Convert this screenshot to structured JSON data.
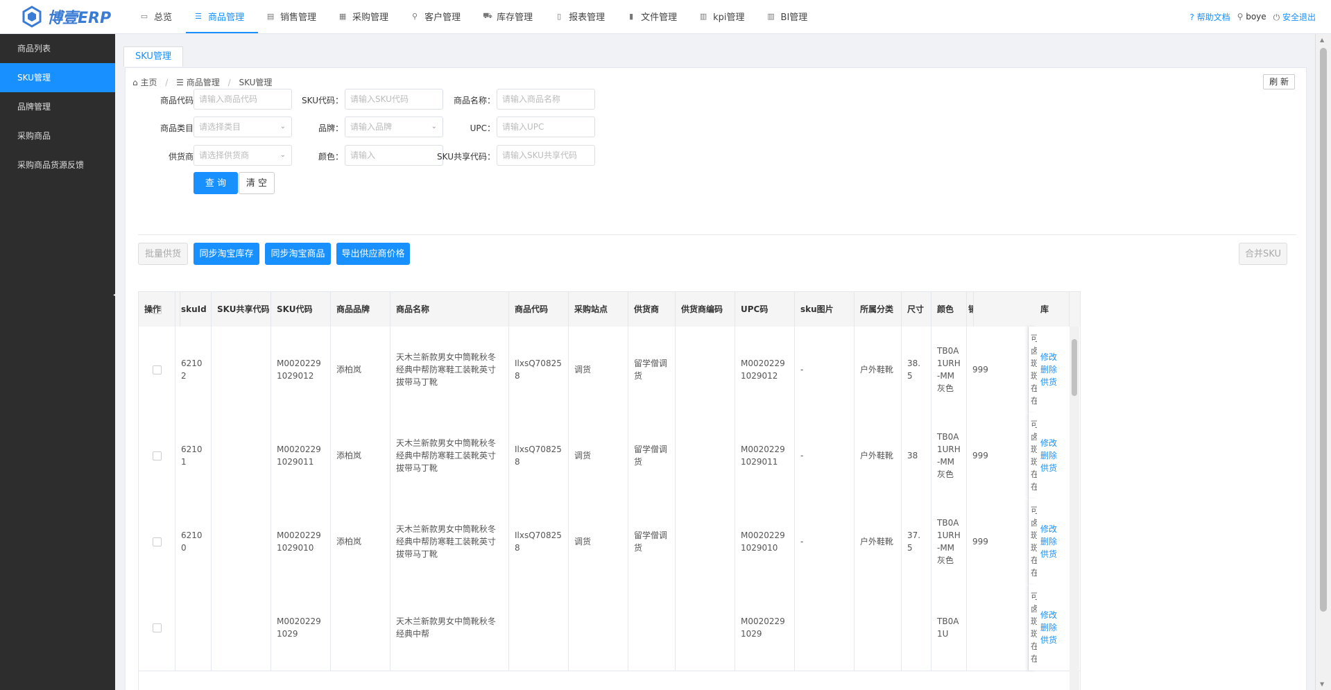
{
  "app": {
    "logo_text": "博壹ERP"
  },
  "nav": [
    {
      "label": "总览",
      "icon": "monitor-icon"
    },
    {
      "label": "商品管理",
      "icon": "list-icon",
      "active": true
    },
    {
      "label": "销售管理",
      "icon": "clipboard-icon"
    },
    {
      "label": "采购管理",
      "icon": "grid-icon"
    },
    {
      "label": "客户管理",
      "icon": "user-icon"
    },
    {
      "label": "库存管理",
      "icon": "cart-icon"
    },
    {
      "label": "报表管理",
      "icon": "document-icon"
    },
    {
      "label": "文件管理",
      "icon": "file-icon"
    },
    {
      "label": "kpi管理",
      "icon": "chart-icon"
    },
    {
      "label": "BI管理",
      "icon": "chart-icon"
    }
  ],
  "topright": {
    "help": "帮助文档",
    "user": "boye",
    "logout": "安全退出"
  },
  "sidebar": [
    {
      "label": "商品列表"
    },
    {
      "label": "SKU管理",
      "active": true
    },
    {
      "label": "品牌管理"
    },
    {
      "label": "采购商品"
    },
    {
      "label": "采购商品货源反馈"
    }
  ],
  "tab": {
    "label": "SKU管理"
  },
  "breadcrumb": {
    "home": "主页",
    "section": "商品管理",
    "current": "SKU管理"
  },
  "refresh_label": "刷 新",
  "filters": {
    "product_code": {
      "label": "商品代码：",
      "placeholder": "请输入商品代码"
    },
    "sku_code": {
      "label": "SKU代码：",
      "placeholder": "请输入SKU代码"
    },
    "product_name": {
      "label": "商品名称：",
      "placeholder": "请输入商品名称"
    },
    "category": {
      "label": "商品类目：",
      "placeholder": "请选择类目"
    },
    "brand": {
      "label": "品牌：",
      "placeholder": "请输入品牌"
    },
    "upc": {
      "label": "UPC：",
      "placeholder": "请输入UPC"
    },
    "supplier": {
      "label": "供货商：",
      "placeholder": "请选择供货商"
    },
    "color": {
      "label": "颜色：",
      "placeholder": "请输入"
    },
    "sku_share": {
      "label": "SKU共享代码：",
      "placeholder": "请输入SKU共享代码"
    }
  },
  "buttons": {
    "query": "查 询",
    "clear": "清 空",
    "batch_supply": "批量供货",
    "sync_stock": "同步淘宝库存",
    "sync_goods": "同步淘宝商品",
    "export_price": "导出供应商价格",
    "merge_sku": "合并SKU"
  },
  "table": {
    "headers": [
      "skuId",
      "SKU共享代码",
      "SKU代码",
      "商品品牌",
      "商品名称",
      "商品代码",
      "采购站点",
      "供货商",
      "供货商编码",
      "UPC码",
      "sku图片",
      "所属分类",
      "尺寸",
      "颜色",
      "销售价格(元)",
      "库",
      "操作"
    ],
    "ops": [
      "修改",
      "删除",
      "供货"
    ],
    "overflow_col_chars": [
      "可",
      "卤",
      "斑",
      "斑",
      "在",
      "在"
    ],
    "rows": [
      {
        "skuId": "62102",
        "share": "",
        "sku": "M00202291029012",
        "brand": "添柏岚",
        "name": "天木兰新款男女中筒靴秋冬经典中帮防寒鞋工装靴英寸拔带马丁靴",
        "code": "IlxsQ708258",
        "site": "调货",
        "supplier": "留学僧调货",
        "supplier_code": "",
        "upc": "M00202291029012",
        "img": "-",
        "category": "户外鞋靴",
        "size": "38.5",
        "color": "TB0A1URH-MM灰色",
        "price": "999"
      },
      {
        "skuId": "62101",
        "share": "",
        "sku": "M00202291029011",
        "brand": "添柏岚",
        "name": "天木兰新款男女中筒靴秋冬经典中帮防寒鞋工装靴英寸拔带马丁靴",
        "code": "IlxsQ708258",
        "site": "调货",
        "supplier": "留学僧调货",
        "supplier_code": "",
        "upc": "M00202291029011",
        "img": "-",
        "category": "户外鞋靴",
        "size": "38",
        "color": "TB0A1URH-MM灰色",
        "price": "999"
      },
      {
        "skuId": "62100",
        "share": "",
        "sku": "M00202291029010",
        "brand": "添柏岚",
        "name": "天木兰新款男女中筒靴秋冬经典中帮防寒鞋工装靴英寸拔带马丁靴",
        "code": "IlxsQ708258",
        "site": "调货",
        "supplier": "留学僧调货",
        "supplier_code": "",
        "upc": "M00202291029010",
        "img": "-",
        "category": "户外鞋靴",
        "size": "37.5",
        "color": "TB0A1URH-MM灰色",
        "price": "999"
      },
      {
        "skuId": "",
        "share": "",
        "sku": "M00202291029",
        "brand": "",
        "name": "天木兰新款男女中筒靴秋冬经典中帮",
        "code": "",
        "site": "",
        "supplier": "",
        "supplier_code": "",
        "upc": "M00202291029",
        "img": "",
        "category": "",
        "size": "",
        "color": "TB0A1U",
        "price": ""
      }
    ]
  }
}
